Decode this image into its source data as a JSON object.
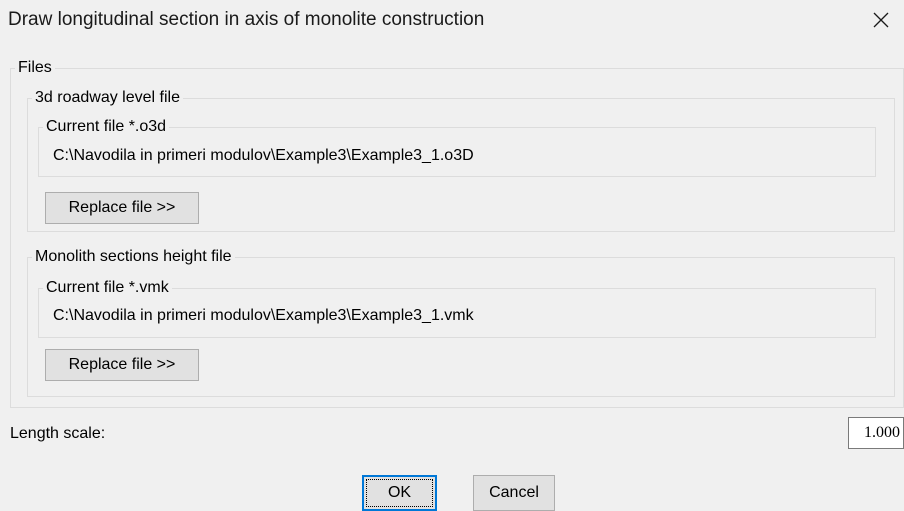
{
  "window": {
    "title": "Draw longitudinal section in axis of monolite construction"
  },
  "files": {
    "legend": "Files",
    "roadway": {
      "legend": "3d roadway level file",
      "current_legend": "Current file *.o3d",
      "path": "C:\\Navodila in primeri modulov\\Example3\\Example3_1.o3D",
      "replace_label": "Replace file >>"
    },
    "monolith": {
      "legend": "Monolith sections height file",
      "current_legend": "Current file *.vmk",
      "path": "C:\\Navodila in primeri modulov\\Example3\\Example3_1.vmk",
      "replace_label": "Replace file >>"
    }
  },
  "length_scale": {
    "label": "Length scale:",
    "value": "1.000"
  },
  "buttons": {
    "ok_label": "OK",
    "cancel_label": "Cancel"
  },
  "icons": {
    "close": "close-icon"
  },
  "colors": {
    "background": "#f0f0f0",
    "button_face": "#e1e1e1",
    "default_button_border": "#0078d7"
  }
}
